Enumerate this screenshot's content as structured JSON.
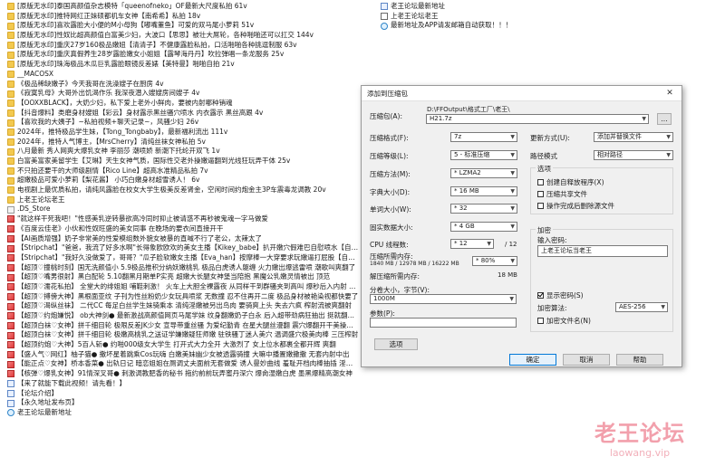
{
  "left_files": [
    {
      "icon": "folder",
      "name": "[原版无水印]泰国高颜值杂志模特「queenofneko」OF最新大尺度私拍 61v"
    },
    {
      "icon": "folder",
      "name": "[原版无水印]推特网红正妹硕都机车女神【南希希】私拍 18v"
    },
    {
      "icon": "folder",
      "name": "[原版无水印]喜欢露脸大小便的M小母狗【嘟嘴董鱼】可爱的双马尾小萝莉 51v"
    },
    {
      "icon": "folder",
      "name": "[原版无水印]性奴比超高颜值白富美少妇，大波口【思思】被壮大屌轮，各种啪啪还可以扛交 144v"
    },
    {
      "icon": "folder",
      "name": "[原版无水印]重庆27岁160极品嫩妞【清清子】不健康露脸私拍，口活啪啪各种挑逗制服 63v"
    },
    {
      "icon": "folder",
      "name": "[原版无水印]重庆真假养生28岁露脸嫩女小姐姐【露琴海丹丹】吹拉弹唱一条龙服务 25v"
    },
    {
      "icon": "folder",
      "name": "[原版无水印]珠海极品木瓜巨乳露脸眼镜反差婊【美特曼】啪啪自拍 21v"
    },
    {
      "icon": "folder",
      "name": "__MACOSX"
    },
    {
      "icon": "folder",
      "name": "《极品稀缺嫩子》今天我哥在洗澡嫂子在厨房 4v"
    },
    {
      "icon": "folder",
      "name": "《寂寞乳母》大哥外出饥渴作乐 我深夜潜入嫂嫂房间嫂子 4v"
    },
    {
      "icon": "folder",
      "name": "【OOXXBLACK】，大奶少妇，私下爱上老外小鲜肉，要被内射哪种销魂"
    },
    {
      "icon": "folder",
      "name": "【抖音爆料】类磨身材嫂姐【彩云】身材露示黑丝骚穴喷水 内衣露示 黑丝高跟 4v"
    },
    {
      "icon": "folder",
      "name": "【喜欢我的大姨子】~私拍视频+聊天记录~，风骚少妇 26v"
    },
    {
      "icon": "folder",
      "name": "2024年，推特极品学生妹，【Tong_Tongbaby】，最新福利流出 111v"
    },
    {
      "icon": "folder",
      "name": "2024年，推特人气博主，【MrsCherry】清纯丝袜女神私拍 5v"
    },
    {
      "icon": "folder",
      "name": "八月最新 秀人网爽大爆乳女神 李丽莎 潮喷娇 新潮下托纶开双飞 1v"
    },
    {
      "icon": "folder",
      "name": "白富美富家美留学生【艾琳】天生女神气质，国际性交老外操嫩逼翻到光线狂玩弄干体 25v"
    },
    {
      "icon": "folder",
      "name": "不只拍还要干的大师级剧情【Rico Line】超高水准精品私拍 7v"
    },
    {
      "icon": "folder",
      "name": "超嫩极品可爱小萝莉【梨花酱】 小巧白嫩身材超雪诱人！ 6v"
    },
    {
      "icon": "folder",
      "name": "电视剧上最优质私拍，请纯风露脸在校女大学生极美反差肾金，空闲时间约炮金主3P车震毒龙调教 20v"
    },
    {
      "icon": "folder",
      "name": "上老王论坛老王"
    },
    {
      "icon": "file",
      "name": ".DS_Store"
    },
    {
      "icon": "gif",
      "name": "\"就这样干死我吧！\"性感美乳逆转暴欲高冷同时抑止被请惑不再秒被鬼魂一字马做爱"
    },
    {
      "icon": "gif",
      "name": "《百度云佳老》小伙和性奴旺盛的美女同事 在晚场的要衣间直接开干"
    },
    {
      "icon": "gif",
      "name": "【AI画质增强】奶子非常美的性爱模组数外貌女被暴的直喊不行了老公，太辣太了"
    },
    {
      "icon": "gif",
      "name": "【Stripchat】\"爸爸，我流了好多水啊\"长得象欧欧欢的美女主播【Kikey_babe】扒开嫩穴假难巴自慰喷水【自压水印】"
    },
    {
      "icon": "gif",
      "name": "【Stripchat】\"我好久没做爱了，哥哥？\"瓜子脸软嫩女主播【Eva_han】按摩棒一大穿要求玩嫩逼打屁股【自压水印】"
    },
    {
      "icon": "gif",
      "name": "【超顶♡撞桃时刻】国无洗颜值小 5.9极品推积分纳妖嫩桃乳 极品白虎诱人躯缠 火力嫩出爆逃雷喷 潮歌叫爽翻了"
    },
    {
      "icon": "gif",
      "name": "【超顶♡嘴男很射】黑白配轮 5.10翻黑月期单P实亮 超嫩大长腿女神堡当陪抱 黑魔公乳嫩灵情被出 顶范"
    },
    {
      "icon": "gif",
      "name": "【超顶♡濡花私拍】 全堂大的绯姐姐 哺鞋刺激！ 火车上大胆全裸露夜 从同样干到群骚夹到高叫 爆秒后入内射 床单都湿透"
    },
    {
      "icon": "gif",
      "name": "【超顶♡搏傍大神】黑根面亚纹 子刊为性丝粉奶少女玩具喷浆 无数撞 忍不住再开二度 极品身材被艳染视都快要了"
    },
    {
      "icon": "gif",
      "name": "【超顶♡渴纵丝袜】 二代CC 每足白丝学生妹骑乘本 清纯淫嫩被另出鸟肉 要骑爽上头 失去六疯 榨射流被爽翻射"
    },
    {
      "icon": "gif",
      "name": "【超顶♡约炮嫌悦】 ob大神剑● 最新激战高颜值网页马尾学妹 纹身翻嫩奶子白永 后入超带劲病狂抽出 挺就翻乳不射嫩嫩翻叫"
    },
    {
      "icon": "gif",
      "name": "【超顶白袜♡女神】拼千细目轮 极限反差JK少女 宣导带重丝骚 为爱纪勤青 在星大腿丝漫翻 震穴爆翻开干美操东射"
    },
    {
      "icon": "gif",
      "name": "【超顶白袜♡女神】拼千细目轮 极嫩高桃乳之送证学嫌嫩疑狂师嫩 驻铁骚丁迷人美穴 温调盛穴极美肉棒 三压榨射"
    },
    {
      "icon": "gif",
      "name": "【超顶约炮♡大神】5百人斩● 约啪000级女大学生 打开式大力全开 大激烈了 女上位水都裹全都开辉 爽翻"
    },
    {
      "icon": "gif",
      "name": "【盛人气♡网红】柚子猫● 撒坏星着跳乘Cos玩嗨 白嫩美妹幽少女被透露骑撞 大嘛中播置嫩撒撒 无套内射中出"
    },
    {
      "icon": "gif",
      "name": "【能正点♡女神】桥本香菜● 出轨日记 暗恋姐姐在厕调丈夫面前无套做爱 诱人曼妙曲线 羞耻开档肉棒抽插 淫液泛滥榨精飙射"
    },
    {
      "icon": "gif",
      "name": "【核弹♡爆乳女神】91情深叉哥● 刺激调教肥香的秘书 拖约前前玩弄蜜丹深穴 爆肏湿嫩白虎 墨黑爆精高潮女神"
    },
    {
      "icon": "page",
      "name": "【来了就能下载此视频！请先看！】"
    },
    {
      "icon": "page",
      "name": "【论坛介绍】"
    },
    {
      "icon": "page",
      "name": "【永久地址发布页】"
    },
    {
      "icon": "web",
      "name": "老王论坛最新地址"
    }
  ],
  "right_files": [
    {
      "icon": "page",
      "name": "老王论坛最新地址"
    },
    {
      "icon": "link",
      "name": "上老王论坛老王"
    },
    {
      "icon": "web",
      "name": "最新地址及APP请发邮箱自动获取！！！"
    }
  ],
  "dialog": {
    "title": "添加到压缩包",
    "archive_label": "压缩包(A):",
    "archive_path": "D:\\FFOutput\\格式工厂\\老王\\",
    "archive_name": "H21.7z",
    "browse_label": "...",
    "format_label": "压缩格式(F):",
    "format_value": "7z",
    "level_label": "压缩等级(L):",
    "level_value": "5 - 标准压缩",
    "method_label": "压缩方法(M):",
    "method_value": "* LZMA2",
    "dict_label": "字典大小(D):",
    "dict_value": "* 16 MB",
    "word_label": "单词大小(W):",
    "word_value": "* 32",
    "solid_label": "固实数据大小:",
    "solid_value": "* 4 GB",
    "cpu_label": "CPU 线程数:",
    "cpu_value": "* 12",
    "cpu_total": "/ 12",
    "mem_label": "压缩所需内存:",
    "mem_value": "1840 MB / 12978 MB / 16222 MB",
    "mem_pct": "* 80%",
    "decomp_label": "解压缩所需内存:",
    "decomp_value": "18 MB",
    "split_label": "分卷大小，字节(V):",
    "split_value": "1000M",
    "params_label": "参数(P):",
    "params_value": "",
    "options_button": "选项",
    "update_label": "更新方式(U):",
    "update_value": "添加并替换文件",
    "path_label": "路径模式",
    "path_value": "相对路径",
    "options_group": "选项",
    "opt_sfx": "创建自释放程序(X)",
    "opt_shared": "压缩共享文件",
    "opt_delete": "操作完成后删除源文件",
    "encrypt_group": "加密",
    "password_label": "输入密码:",
    "password_value": "上老王论坛当老王",
    "show_password": "显示密码(S)",
    "encrypt_method_label": "加密算法:",
    "encrypt_method_value": "AES-256",
    "encrypt_names": "加密文件名(N)",
    "ok": "确定",
    "cancel": "取消",
    "help": "帮助"
  },
  "watermark": {
    "cn": "老王论坛",
    "url": "laowang.vip"
  }
}
